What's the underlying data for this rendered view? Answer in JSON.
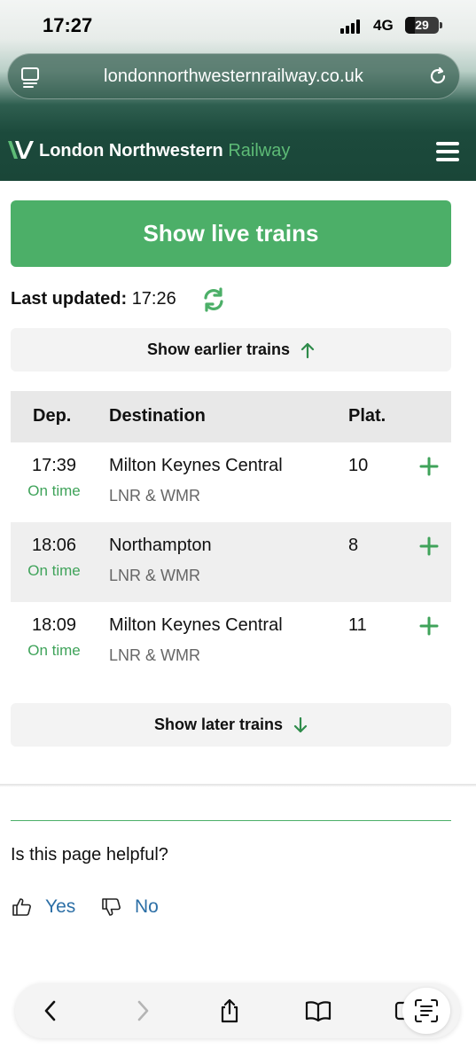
{
  "status_bar": {
    "time": "17:27",
    "network": "4G",
    "battery": "29",
    "battery_fraction": 0.29
  },
  "browser": {
    "url": "londonnorthwesternrailway.co.uk"
  },
  "header": {
    "brand_main": "London Northwestern",
    "brand_accent": "Railway"
  },
  "live_button": "Show live trains",
  "last_updated": {
    "label": "Last updated:",
    "time": "17:26"
  },
  "earlier_button": "Show earlier trains",
  "later_button": "Show later trains",
  "table": {
    "headers": {
      "dep": "Dep.",
      "destination": "Destination",
      "platform": "Plat."
    },
    "rows": [
      {
        "time": "17:39",
        "status": "On time",
        "destination": "Milton Keynes Central",
        "operator": "LNR & WMR",
        "platform": "10"
      },
      {
        "time": "18:06",
        "status": "On time",
        "destination": "Northampton",
        "operator": "LNR & WMR",
        "platform": "8"
      },
      {
        "time": "18:09",
        "status": "On time",
        "destination": "Milton Keynes Central",
        "operator": "LNR & WMR",
        "platform": "11"
      }
    ]
  },
  "feedback": {
    "question": "Is this page helpful?",
    "yes": "Yes",
    "no": "No"
  },
  "colors": {
    "brand_green": "#4caf68",
    "header_dark": "#1a4638",
    "link_blue": "#2c6fa6",
    "on_time_green": "#3fa35a"
  },
  "icons": {
    "url_left": "page-menu-icon",
    "url_right": "reload-icon",
    "logo": "lnr-logo-icon",
    "menu": "hamburger-icon",
    "refresh": "refresh-icon",
    "earlier": "arrow-up-icon",
    "later": "arrow-down-icon",
    "expand": "plus-icon",
    "yes": "thumbs-up-icon",
    "no": "thumbs-down-icon",
    "toolbar": [
      "back-icon",
      "forward-icon",
      "share-icon",
      "bookmarks-icon",
      "tabs-icon",
      "reader-icon"
    ]
  }
}
